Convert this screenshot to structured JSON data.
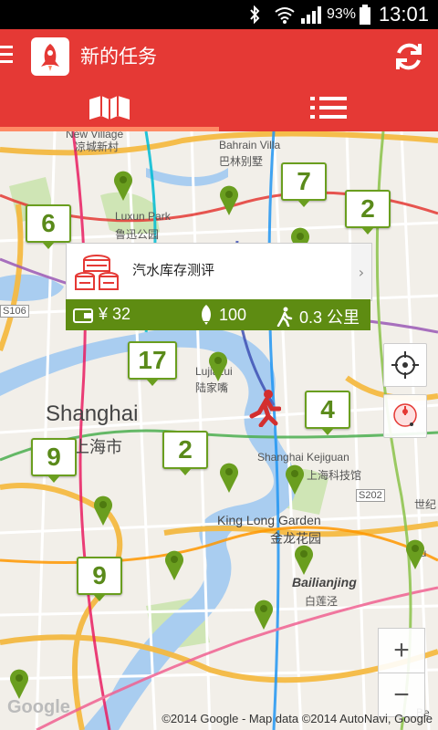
{
  "status_bar": {
    "battery_pct": "93%",
    "time": "13:01"
  },
  "app_bar": {
    "title": "新的任务",
    "menu_icon": "hamburger-icon",
    "logo_icon": "rocket-icon",
    "refresh_icon": "refresh-icon"
  },
  "tabs": [
    {
      "icon": "map-icon",
      "active": true
    },
    {
      "icon": "list-icon",
      "active": false
    }
  ],
  "map": {
    "labels": {
      "new_village_cn": "凉城新村",
      "new_village_en": "New Village",
      "bahrain": "Bahrain Villa",
      "bahrain_cn": "巴林别墅",
      "luxun_park": "Luxun Park",
      "luxun_park_cn": "鲁迅公园",
      "s106": "S106",
      "lujiazui": "Lujiazui",
      "lujiazui_cn": "陆家嘴",
      "shanghai": "Shanghai",
      "shanghai_cn": "上海市",
      "kejiguan": "Shanghai Kejiguan",
      "kejiguan_cn": "上海科技馆",
      "s202": "S202",
      "king_long": "King Long Garden",
      "king_long_cn": "金龙花园",
      "bailianjing": "Bailianjing",
      "bailianjing_cn": "白莲泾",
      "huaqiao": "Hu",
      "beicai": "Be",
      "century": "世纪"
    },
    "count_markers": [
      "6",
      "7",
      "2",
      "17",
      "4",
      "9",
      "2",
      "9"
    ],
    "google_logo": "Google",
    "copyright": "©2014 Google - Map data ©2014 AutoNavi, Google"
  },
  "popup": {
    "title": "汽水库存测评",
    "reward": "¥ 32",
    "points": "100",
    "distance": "0.3 公里",
    "icons": {
      "wallet": "wallet-icon",
      "rocket": "rocket-icon",
      "walk": "walking-icon",
      "chevron": "chevron-right-icon"
    }
  },
  "controls": {
    "locate_icon": "crosshair-icon",
    "layer_icon": "layer-pin-icon",
    "zoom_in": "+",
    "zoom_out": "−"
  },
  "colors": {
    "brand_red": "#e53935",
    "accent_orange": "#ff8a65",
    "marker_green": "#6a9e1f",
    "popup_green": "#5e8c12"
  }
}
